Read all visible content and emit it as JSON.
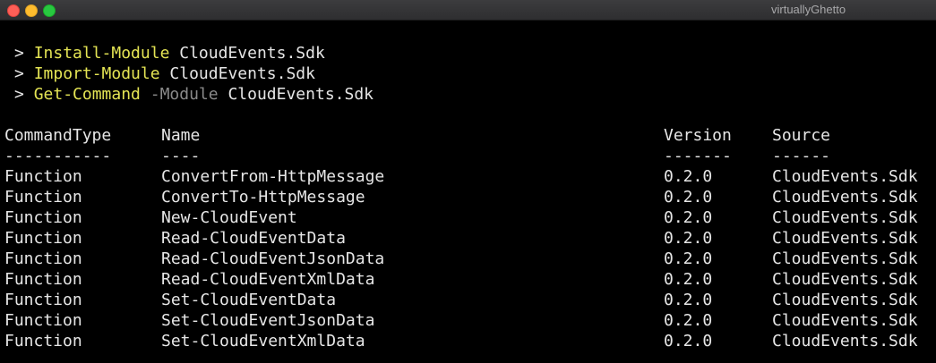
{
  "window": {
    "title": "virtuallyGhetto"
  },
  "prompt_symbol": ">",
  "commands": [
    {
      "cmdlet": "Install-Module",
      "param": "",
      "arg": "CloudEvents.Sdk"
    },
    {
      "cmdlet": "Import-Module",
      "param": "",
      "arg": "CloudEvents.Sdk"
    },
    {
      "cmdlet": "Get-Command",
      "param": "-Module",
      "arg": "CloudEvents.Sdk"
    }
  ],
  "table": {
    "headers": [
      "CommandType",
      "Name",
      "Version",
      "Source"
    ],
    "separators": [
      "-----------",
      "----",
      "-------",
      "------"
    ],
    "rows": [
      [
        "Function",
        "ConvertFrom-HttpMessage",
        "0.2.0",
        "CloudEvents.Sdk"
      ],
      [
        "Function",
        "ConvertTo-HttpMessage",
        "0.2.0",
        "CloudEvents.Sdk"
      ],
      [
        "Function",
        "New-CloudEvent",
        "0.2.0",
        "CloudEvents.Sdk"
      ],
      [
        "Function",
        "Read-CloudEventData",
        "0.2.0",
        "CloudEvents.Sdk"
      ],
      [
        "Function",
        "Read-CloudEventJsonData",
        "0.2.0",
        "CloudEvents.Sdk"
      ],
      [
        "Function",
        "Read-CloudEventXmlData",
        "0.2.0",
        "CloudEvents.Sdk"
      ],
      [
        "Function",
        "Set-CloudEventData",
        "0.2.0",
        "CloudEvents.Sdk"
      ],
      [
        "Function",
        "Set-CloudEventJsonData",
        "0.2.0",
        "CloudEvents.Sdk"
      ],
      [
        "Function",
        "Set-CloudEventXmlData",
        "0.2.0",
        "CloudEvents.Sdk"
      ]
    ]
  },
  "colors": {
    "background": "#000000",
    "text": "#e6e6e6",
    "cmdlet": "#e4e454",
    "parameter": "#8a8a8a",
    "traffic_close": "#fe5f57",
    "traffic_minimize": "#febc2e",
    "traffic_zoom": "#28c840"
  }
}
